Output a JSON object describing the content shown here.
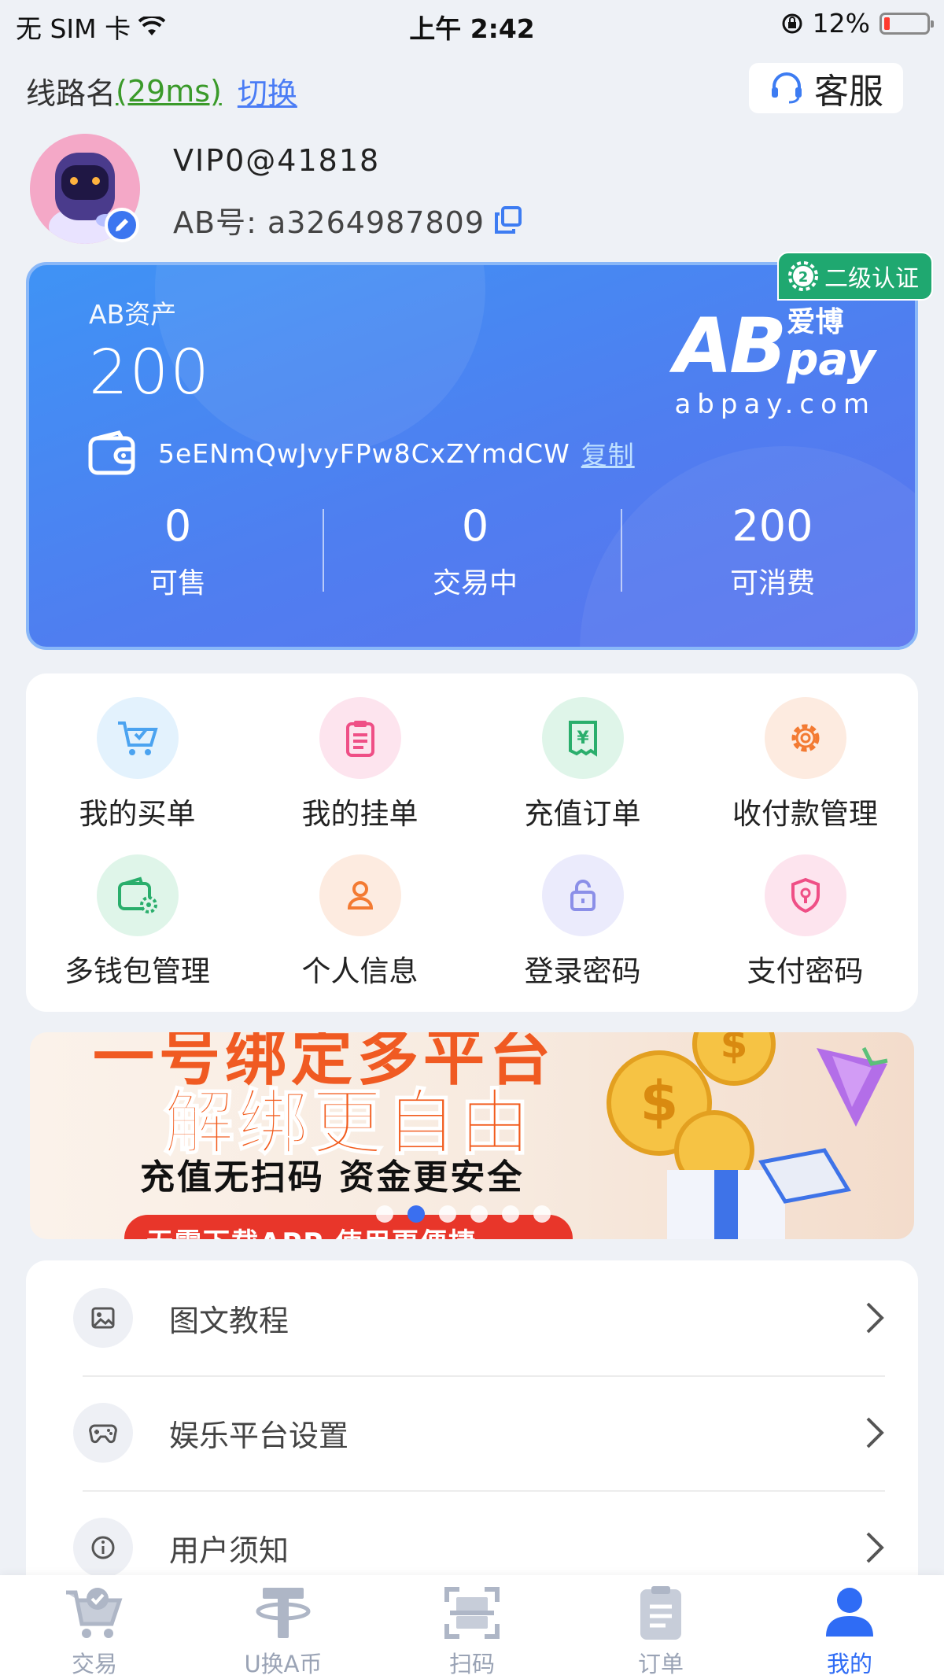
{
  "status_bar": {
    "carrier": "无 SIM 卡",
    "time": "上午 2:42",
    "battery": "12%"
  },
  "route": {
    "label": "线路名",
    "latency": "(29ms)",
    "switch": "切换"
  },
  "service_button": "客服",
  "profile": {
    "username": "VIP0@41818",
    "ab_id": "AB号: a3264987809"
  },
  "asset_card": {
    "label": "AB资产",
    "value": "200",
    "wallet_address": "5eENmQwJvyFPw8CxZYmdCW",
    "copy_label": "复制",
    "logo_cn": "爱博",
    "logo_pay": "pay",
    "logo_ab": "AB",
    "logo_url": "abpay.com",
    "cert_badge": "二级认证",
    "stats": [
      {
        "value": "0",
        "label": "可售"
      },
      {
        "value": "0",
        "label": "交易中"
      },
      {
        "value": "200",
        "label": "可消费"
      }
    ]
  },
  "menu": [
    {
      "label": "我的买单",
      "icon": "cart-icon",
      "color": "#4ba3f0",
      "bg": "#e3f2fd"
    },
    {
      "label": "我的挂单",
      "icon": "clipboard-icon",
      "color": "#ef4f86",
      "bg": "#fde4ee"
    },
    {
      "label": "充值订单",
      "icon": "yuan-receipt-icon",
      "color": "#2aae6c",
      "bg": "#dff5e9"
    },
    {
      "label": "收付款管理",
      "icon": "gear-icon",
      "color": "#f37a32",
      "bg": "#fdebe0"
    },
    {
      "label": "多钱包管理",
      "icon": "wallet-gear-icon",
      "color": "#2aae6c",
      "bg": "#dff5e9"
    },
    {
      "label": "个人信息",
      "icon": "person-icon",
      "color": "#f37a32",
      "bg": "#fdebe0"
    },
    {
      "label": "登录密码",
      "icon": "lock-icon",
      "color": "#8b8fe8",
      "bg": "#ebebfc"
    },
    {
      "label": "支付密码",
      "icon": "shield-key-icon",
      "color": "#ef4f86",
      "bg": "#fde4ee"
    }
  ],
  "banner": {
    "top_line": "一号绑定多平台",
    "title": "解绑更自由",
    "subtitle": "充值无扫码 资金更安全",
    "pill": "无需下载APP 使用更便捷"
  },
  "list": [
    {
      "label": "图文教程",
      "icon": "image-icon"
    },
    {
      "label": "娱乐平台设置",
      "icon": "gamepad-icon"
    },
    {
      "label": "用户须知",
      "icon": "info-icon"
    }
  ],
  "tabs": [
    {
      "label": "交易",
      "icon": "cart-tab-icon",
      "active": false
    },
    {
      "label": "U换A币",
      "icon": "tether-icon",
      "active": false
    },
    {
      "label": "扫码",
      "icon": "scan-icon",
      "active": false
    },
    {
      "label": "订单",
      "icon": "order-icon",
      "active": false
    },
    {
      "label": "我的",
      "icon": "user-icon",
      "active": true
    }
  ]
}
